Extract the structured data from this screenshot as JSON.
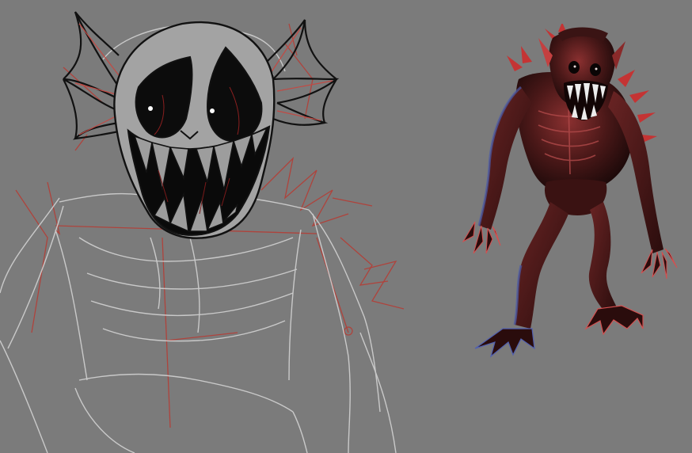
{
  "canvas": {
    "background": "#7b7b7b"
  },
  "colors": {
    "sketch_line": "#cfcfcf",
    "sketch_red": "#c0392b",
    "ink": "#111111",
    "face_fill": "#9e9e9e",
    "eye_fill": "#0a0a0a",
    "creature_dark": "#3a1414",
    "creature_mid": "#6b2222",
    "creature_highlight": "#d03a3a",
    "teeth": "#ececec"
  },
  "artworks": [
    {
      "name": "line-sketch-monster",
      "style": "pencil sketch with inked head"
    },
    {
      "name": "rendered-monster",
      "style": "3d render, red-lit creature"
    }
  ]
}
